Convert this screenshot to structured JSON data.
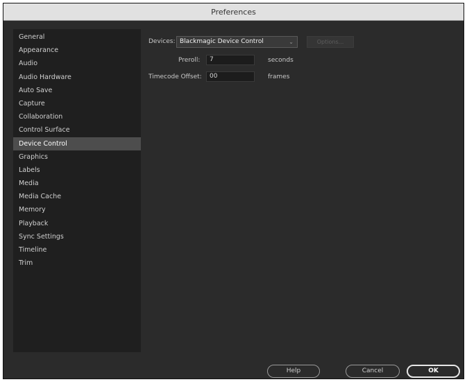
{
  "window": {
    "title": "Preferences"
  },
  "sidebar": {
    "items": [
      {
        "label": "General"
      },
      {
        "label": "Appearance"
      },
      {
        "label": "Audio"
      },
      {
        "label": "Audio Hardware"
      },
      {
        "label": "Auto Save"
      },
      {
        "label": "Capture"
      },
      {
        "label": "Collaboration"
      },
      {
        "label": "Control Surface"
      },
      {
        "label": "Device Control",
        "selected": true
      },
      {
        "label": "Graphics"
      },
      {
        "label": "Labels"
      },
      {
        "label": "Media"
      },
      {
        "label": "Media Cache"
      },
      {
        "label": "Memory"
      },
      {
        "label": "Playback"
      },
      {
        "label": "Sync Settings"
      },
      {
        "label": "Timeline"
      },
      {
        "label": "Trim"
      }
    ]
  },
  "device_control": {
    "devices_label": "Devices:",
    "devices_value": "Blackmagic Device Control",
    "options_label": "Options...",
    "preroll_label": "Preroll:",
    "preroll_value": "7",
    "preroll_unit": "seconds",
    "timecode_offset_label": "Timecode Offset:",
    "timecode_offset_value": "00",
    "timecode_offset_unit": "frames"
  },
  "footer": {
    "help_label": "Help",
    "cancel_label": "Cancel",
    "ok_label": "OK"
  },
  "colors": {
    "dialog_bg": "#2b2b2b",
    "sidebar_bg": "#1f1f1f",
    "selected_bg": "#4d4d4d",
    "titlebar_bg": "#e1e1e1"
  }
}
